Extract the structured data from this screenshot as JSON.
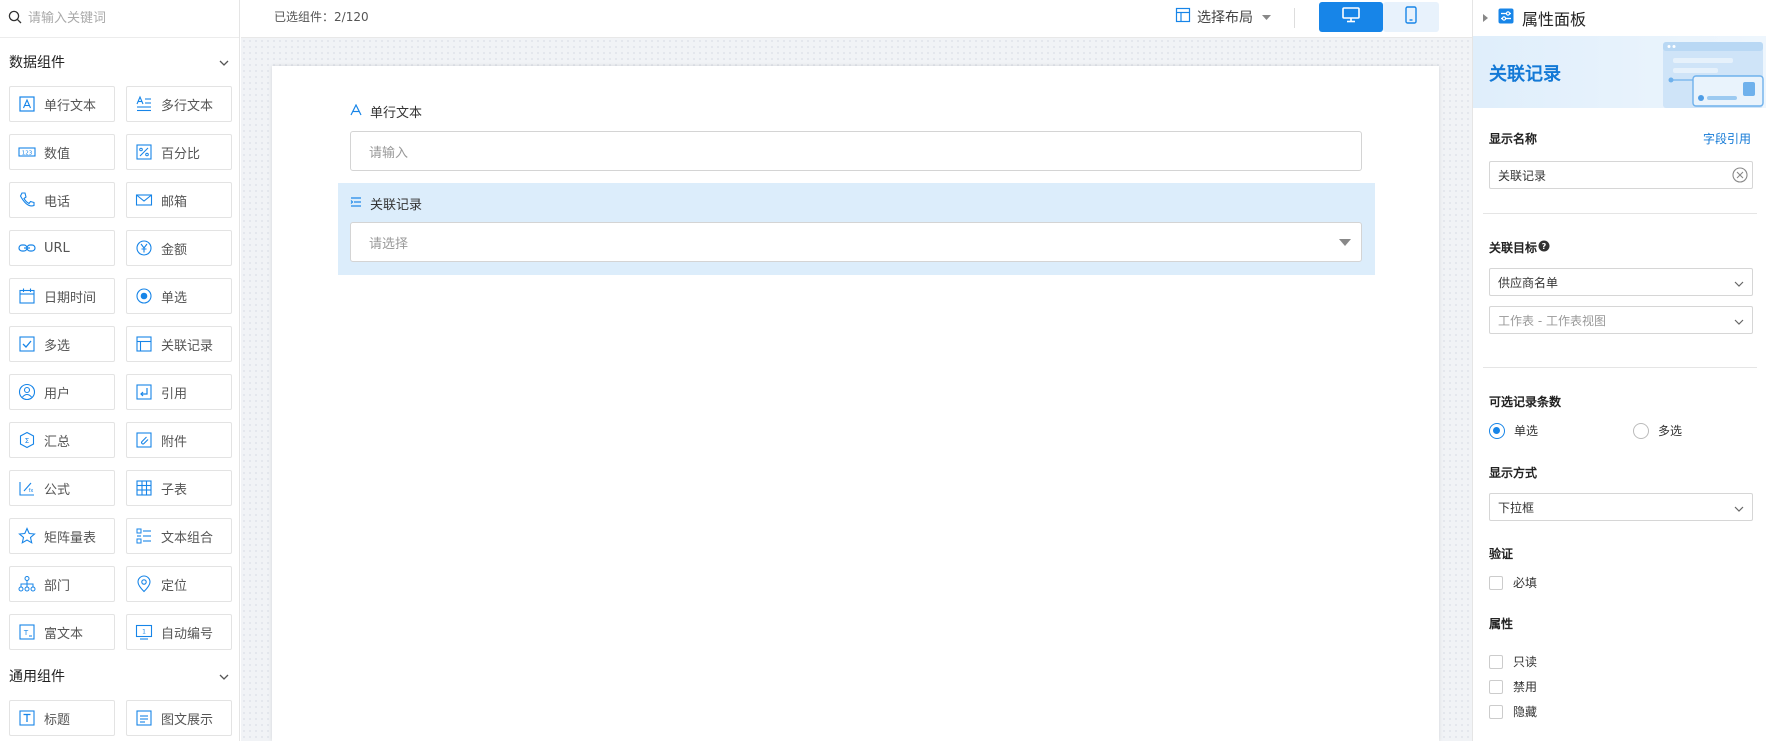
{
  "search": {
    "placeholder": "请输入关键词"
  },
  "sections": [
    {
      "title": "数据组件",
      "items": [
        {
          "label": "单行文本",
          "icon": "single-line-text-icon"
        },
        {
          "label": "多行文本",
          "icon": "multi-line-text-icon"
        },
        {
          "label": "数值",
          "icon": "number-icon"
        },
        {
          "label": "百分比",
          "icon": "percent-icon"
        },
        {
          "label": "电话",
          "icon": "phone-icon"
        },
        {
          "label": "邮箱",
          "icon": "mail-icon"
        },
        {
          "label": "URL",
          "icon": "link-icon"
        },
        {
          "label": "金额",
          "icon": "currency-icon"
        },
        {
          "label": "日期时间",
          "icon": "calendar-icon"
        },
        {
          "label": "单选",
          "icon": "radio-icon"
        },
        {
          "label": "多选",
          "icon": "checkbox-icon"
        },
        {
          "label": "关联记录",
          "icon": "related-record-icon"
        },
        {
          "label": "用户",
          "icon": "user-icon"
        },
        {
          "label": "引用",
          "icon": "reference-icon"
        },
        {
          "label": "汇总",
          "icon": "summary-icon"
        },
        {
          "label": "附件",
          "icon": "attachment-icon"
        },
        {
          "label": "公式",
          "icon": "formula-icon"
        },
        {
          "label": "子表",
          "icon": "subtable-icon"
        },
        {
          "label": "矩阵量表",
          "icon": "matrix-scale-icon"
        },
        {
          "label": "文本组合",
          "icon": "text-group-icon"
        },
        {
          "label": "部门",
          "icon": "department-icon"
        },
        {
          "label": "定位",
          "icon": "location-icon"
        },
        {
          "label": "富文本",
          "icon": "rich-text-icon"
        },
        {
          "label": "自动编号",
          "icon": "auto-number-icon"
        }
      ]
    },
    {
      "title": "通用组件",
      "items": [
        {
          "label": "标题",
          "icon": "heading-icon"
        },
        {
          "label": "图文展示",
          "icon": "image-text-icon"
        }
      ]
    }
  ],
  "topbar": {
    "selected_label": "已选组件：",
    "selected_count": "2/120",
    "layout_label": "选择布局"
  },
  "canvas": {
    "field1": {
      "label": "单行文本",
      "placeholder": "请输入"
    },
    "field2": {
      "label": "关联记录",
      "placeholder": "请选择"
    }
  },
  "props": {
    "title": "属性面板",
    "banner_title": "关联记录",
    "display_name_label": "显示名称",
    "field_ref_link": "字段引用",
    "display_name_value": "关联记录",
    "target_label": "关联目标",
    "target_value": "供应商名单",
    "view_placeholder": "工作表 - 工作表视图",
    "count_label": "可选记录条数",
    "radio_single": "单选",
    "radio_multi": "多选",
    "display_mode_label": "显示方式",
    "display_mode_value": "下拉框",
    "validation_label": "验证",
    "required_label": "必填",
    "attr_label": "属性",
    "readonly_label": "只读",
    "disabled_label": "禁用",
    "hidden_label": "隐藏"
  },
  "colors": {
    "accent": "#1785e8",
    "selected_bg": "#dcedfb"
  }
}
